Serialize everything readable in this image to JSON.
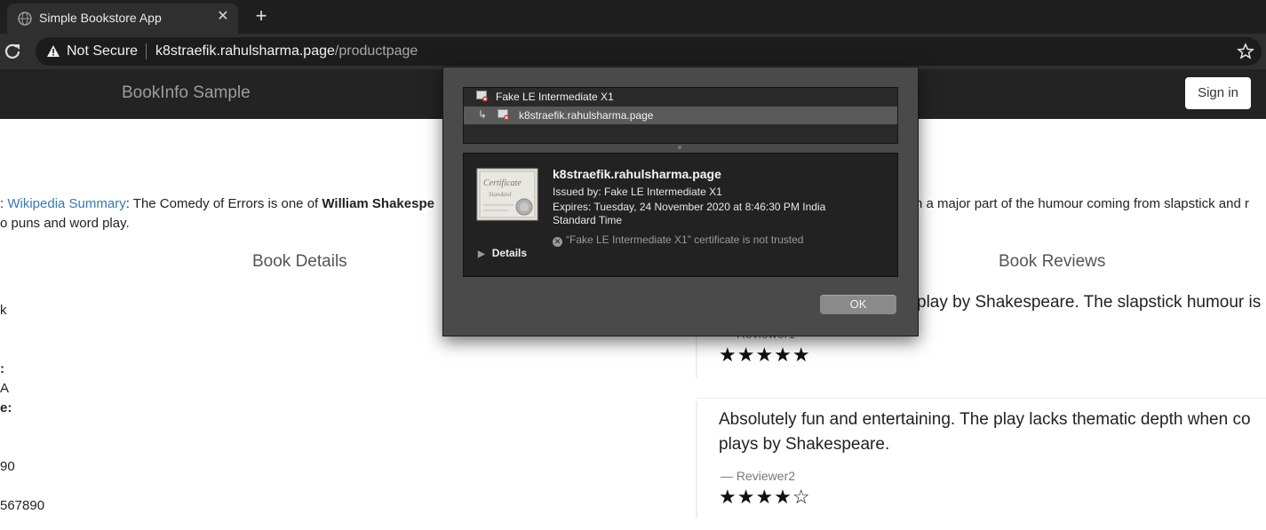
{
  "browser": {
    "tab_title": "Simple Bookstore App",
    "new_tab_symbol": "+",
    "close_symbol": "✕",
    "security_label": "Not Secure",
    "url_host": "k8straefik.rahulsharma.page",
    "url_path": "/productpage"
  },
  "navbar": {
    "brand": "BookInfo Sample",
    "sign_in": "Sign in"
  },
  "summary": {
    "prefix": ": ",
    "link": "Wikipedia Summary",
    "text_start": ": The Comedy of Errors is one of ",
    "author": "William Shakespe",
    "text_right": "h a major part of the humour coming from slapstick and r",
    "line2": "o puns and word play."
  },
  "details": {
    "heading": "Book Details",
    "fragments": [
      "k",
      ":",
      "A",
      "e:",
      "90",
      "567890"
    ]
  },
  "reviews": {
    "heading": "Book Reviews",
    "items": [
      {
        "text_line1": "play by Shakespeare. The slapstick humour is",
        "reviewer": "— Reviewer1",
        "stars": "★★★★★",
        "rating": 5
      },
      {
        "text_line1": "Absolutely fun and entertaining. The play lacks thematic depth when co",
        "text_line2": "plays by Shakespeare.",
        "reviewer": "— Reviewer2",
        "stars": "★★★★☆",
        "rating": 4
      }
    ]
  },
  "certificate_sheet": {
    "chain": [
      {
        "label": "Fake LE Intermediate X1",
        "selected": false
      },
      {
        "label": "k8straefik.rahulsharma.page",
        "selected": true,
        "arrow": "↳"
      }
    ],
    "cert_image_text": [
      "Certificate",
      "Standard"
    ],
    "title": "k8straefik.rahulsharma.page",
    "issued_by": "Issued by: Fake LE Intermediate X1",
    "expires_line1": "Expires: Tuesday, 24 November 2020 at 8:46:30 PM India",
    "expires_line2": "Standard Time",
    "warning": "“Fake LE Intermediate X1” certificate is not trusted",
    "details_label": "Details",
    "ok_label": "OK"
  },
  "colors": {
    "link": "#337ab7",
    "navbar_bg": "#232323",
    "sheet_bg": "#4a4a4a"
  },
  "icons": [
    "globe-icon",
    "close-icon",
    "plus-icon",
    "reload-icon",
    "warning-icon",
    "star-bookmark-icon",
    "certificate-icon",
    "error-icon",
    "disclosure-triangle-icon"
  ]
}
